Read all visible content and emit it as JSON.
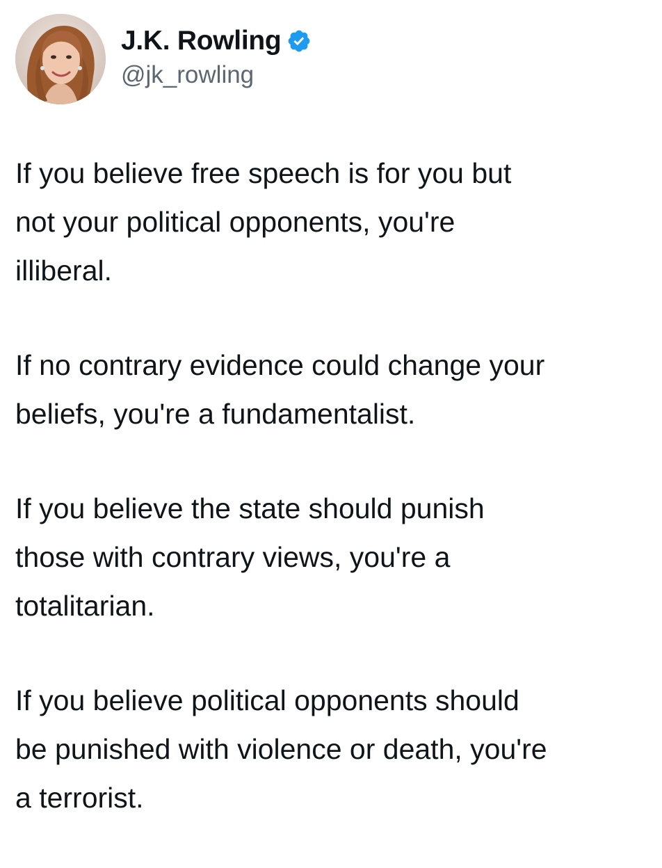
{
  "author": {
    "display_name": "J.K. Rowling",
    "handle": "@jk_rowling",
    "verified": true,
    "verified_icon": "verified-badge-icon",
    "verified_color": "#1d9bf0",
    "avatar": "profile-photo"
  },
  "tweet": {
    "paragraphs": [
      "If you believe free speech is for you but\nnot your political opponents, you're\nilliberal.",
      "If no contrary evidence could change your\nbeliefs, you're a fundamentalist.",
      "If you believe the state should punish\nthose with contrary views, you're a\ntotalitarian.",
      "If you believe political opponents should\nbe punished with violence or death, you're\na terrorist."
    ]
  }
}
